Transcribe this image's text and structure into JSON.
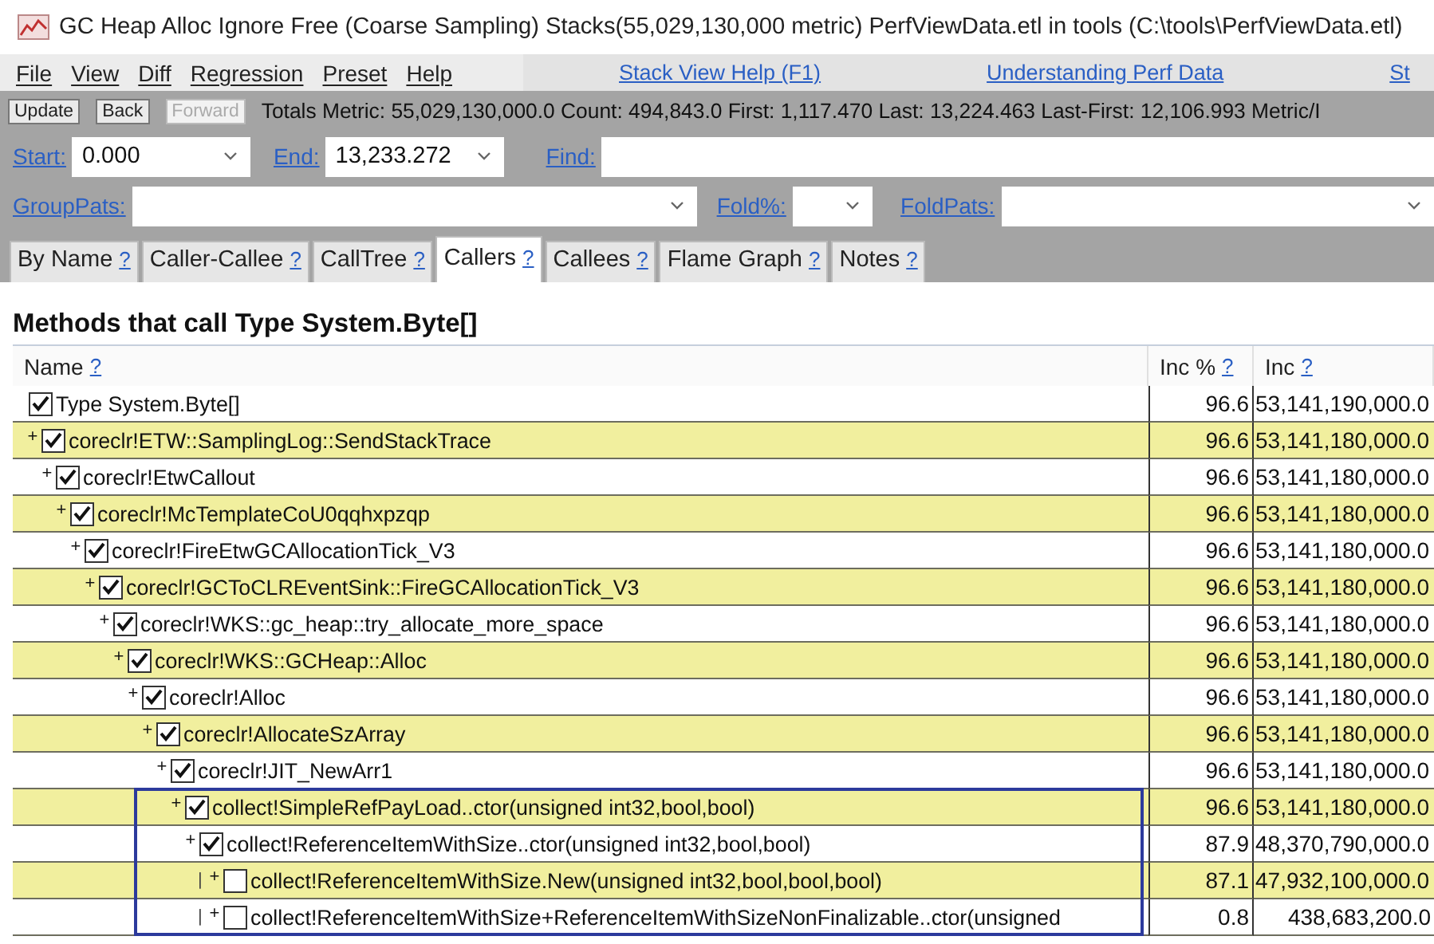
{
  "window": {
    "title": "GC Heap Alloc Ignore Free (Coarse Sampling) Stacks(55,029,130,000 metric) PerfViewData.etl in tools (C:\\tools\\PerfViewData.etl)"
  },
  "menu": [
    "File",
    "View",
    "Diff",
    "Regression",
    "Preset",
    "Help"
  ],
  "help_links": [
    "Stack View Help (F1)",
    "Understanding Perf Data",
    "St"
  ],
  "toolbar": {
    "buttons": [
      {
        "label": "Update",
        "disabled": false
      },
      {
        "label": "Back",
        "disabled": false
      },
      {
        "label": "Forward",
        "disabled": true
      }
    ],
    "stats": "Totals Metric: 55,029,130,000.0  Count: 494,843.0  First: 1,117.470 Last: 13,224.463  Last-First: 12,106.993  Metric/I"
  },
  "range": {
    "start_label": "Start:",
    "start_value": "0.000",
    "end_label": "End:",
    "end_value": "13,233.272",
    "find_label": "Find:"
  },
  "patterns": {
    "grouppats_label": "GroupPats:",
    "fold_pct_label": "Fold%:",
    "foldpats_label": "FoldPats:"
  },
  "tabs": [
    {
      "label": "By Name",
      "help": "?",
      "selected": false
    },
    {
      "label": "Caller-Callee",
      "help": "?",
      "selected": false
    },
    {
      "label": "CallTree",
      "help": "?",
      "selected": false
    },
    {
      "label": "Callers",
      "help": "?",
      "selected": true
    },
    {
      "label": "Callees",
      "help": "?",
      "selected": false
    },
    {
      "label": "Flame Graph",
      "help": "?",
      "selected": false
    },
    {
      "label": "Notes",
      "help": "?",
      "selected": false
    }
  ],
  "heading": "Methods that call Type System.Byte[]",
  "table": {
    "columns": [
      {
        "label": "Name",
        "help": "?"
      },
      {
        "label": "Inc %",
        "help": "?"
      },
      {
        "label": "Inc",
        "help": "?"
      }
    ],
    "rows": [
      {
        "name": "Type System.Byte[]",
        "checked": true,
        "selected": false,
        "inc_pct": "96.6",
        "inc": "53,141,190,000.0",
        "children": [
          {
            "expander": "+",
            "name": "coreclr!ETW::SamplingLog::SendStackTrace",
            "checked": true,
            "selected": false,
            "inc_pct": "96.6",
            "inc": "53,141,180,000.0",
            "children": [
              {
                "expander": "+",
                "name": "coreclr!EtwCallout",
                "checked": true,
                "selected": false,
                "inc_pct": "96.6",
                "inc": "53,141,180,000.0",
                "children": [
                  {
                    "expander": "+",
                    "name": "coreclr!McTemplateCoU0qqhxpzqp",
                    "checked": true,
                    "selected": false,
                    "inc_pct": "96.6",
                    "inc": "53,141,180,000.0",
                    "children": [
                      {
                        "expander": "+",
                        "name": "coreclr!FireEtwGCAllocationTick_V3",
                        "checked": true,
                        "selected": false,
                        "inc_pct": "96.6",
                        "inc": "53,141,180,000.0",
                        "children": [
                          {
                            "expander": "+",
                            "name": "coreclr!GCToCLREventSink::FireGCAllocationTick_V3",
                            "checked": true,
                            "selected": false,
                            "inc_pct": "96.6",
                            "inc": "53,141,180,000.0",
                            "children": [
                              {
                                "expander": "+",
                                "name": "coreclr!WKS::gc_heap::try_allocate_more_space",
                                "checked": true,
                                "selected": false,
                                "inc_pct": "96.6",
                                "inc": "53,141,180,000.0",
                                "children": [
                                  {
                                    "expander": "+",
                                    "name": "coreclr!WKS::GCHeap::Alloc",
                                    "checked": true,
                                    "selected": false,
                                    "inc_pct": "96.6",
                                    "inc": "53,141,180,000.0",
                                    "children": [
                                      {
                                        "expander": "+",
                                        "name": "coreclr!Alloc",
                                        "checked": true,
                                        "selected": false,
                                        "inc_pct": "96.6",
                                        "inc": "53,141,180,000.0",
                                        "children": [
                                          {
                                            "expander": "+",
                                            "name": "coreclr!AllocateSzArray",
                                            "checked": true,
                                            "selected": false,
                                            "inc_pct": "96.6",
                                            "inc": "53,141,180,000.0",
                                            "children": [
                                              {
                                                "expander": "+",
                                                "name": "coreclr!JIT_NewArr1",
                                                "checked": true,
                                                "selected": false,
                                                "inc_pct": "96.6",
                                                "inc": "53,141,180,000.0",
                                                "children": [
                                                  {
                                                    "expander": "+",
                                                    "name": "collect!SimpleRefPayLoad..ctor(unsigned int32,bool,bool)",
                                                    "checked": true,
                                                    "selected": true,
                                                    "inc_pct": "96.6",
                                                    "inc": "53,141,180,000.0",
                                                    "children": [
                                                      {
                                                        "expander": "+",
                                                        "name": "collect!ReferenceItemWithSize..ctor(unsigned int32,bool,bool)",
                                                        "checked": true,
                                                        "selected": true,
                                                        "inc_pct": "87.9",
                                                        "inc": "48,370,790,000.0",
                                                        "children": [
                                                          {
                                                            "guide": "|",
                                                            "expander": "+",
                                                            "name": "collect!ReferenceItemWithSize.New(unsigned int32,bool,bool,bool)",
                                                            "checked": false,
                                                            "selected": true,
                                                            "inc_pct": "87.1",
                                                            "inc": "47,932,100,000.0"
                                                          },
                                                          {
                                                            "guide": "|",
                                                            "expander": "+",
                                                            "name": "collect!ReferenceItemWithSize+ReferenceItemWithSizeNonFinalizable..ctor(unsigned",
                                                            "checked": false,
                                                            "selected": true,
                                                            "inc_pct": "0.8",
                                                            "inc": "438,683,200.0"
                                                          }
                                                        ]
                                                      }
                                                    ]
                                                  }
                                                ]
                                              }
                                            ]
                                          }
                                        ]
                                      }
                                    ]
                                  }
                                ]
                              }
                            ]
                          }
                        ]
                      }
                    ]
                  }
                ]
              }
            ]
          }
        ]
      }
    ]
  }
}
